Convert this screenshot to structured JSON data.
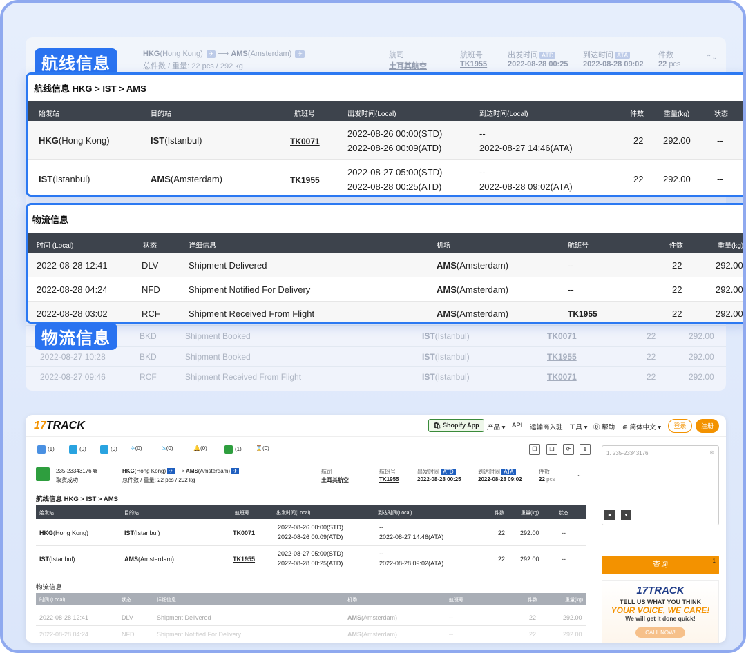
{
  "ghost_summary": {
    "origin_code": "HKG",
    "origin_name": "(Hong Kong)",
    "dest_code": "AMS",
    "dest_name": "(Amsterdam)",
    "weight_line": "总件数 / 重量: 22 pcs / 292 kg",
    "airline_label": "航司",
    "airline": "土耳其航空",
    "flight_label": "航班号",
    "flight": "TK1955",
    "dep_label": "出发时间",
    "dep_tag": "ATD",
    "dep_time": "2022-08-28 00:25",
    "arr_label": "到达时间",
    "arr_tag": "ATA",
    "arr_time": "2022-08-28 09:02",
    "pcs_label": "件数",
    "pcs": "22",
    "pcs_unit": "pcs"
  },
  "banners": {
    "route": "航线信息",
    "logistics": "物流信息"
  },
  "route_card": {
    "title": "航线信息   HKG > IST > AMS",
    "headers": [
      "始发站",
      "目的站",
      "航班号",
      "出发时间(Local)",
      "到达时间(Local)",
      "件数",
      "重量(kg)",
      "状态"
    ],
    "rows": [
      {
        "from_code": "HKG",
        "from_name": "(Hong Kong)",
        "to_code": "IST",
        "to_name": "(Istanbul)",
        "flight": "TK0071",
        "dep1": "2022-08-26 00:00(STD)",
        "dep2": "2022-08-26 00:09(ATD)",
        "arr1": "--",
        "arr2": "2022-08-27 14:46(ATA)",
        "pcs": "22",
        "weight": "292.00",
        "status": "--"
      },
      {
        "from_code": "IST",
        "from_name": "(Istanbul)",
        "to_code": "AMS",
        "to_name": "(Amsterdam)",
        "flight": "TK1955",
        "dep1": "2022-08-27 05:00(STD)",
        "dep2": "2022-08-28 00:25(ATD)",
        "arr1": "--",
        "arr2": "2022-08-28 09:02(ATA)",
        "pcs": "22",
        "weight": "292.00",
        "status": "--"
      }
    ]
  },
  "logistics_card": {
    "title": "物流信息",
    "headers": [
      "时间 (Local)",
      "状态",
      "详细信息",
      "机场",
      "航班号",
      "件数",
      "重量(kg)"
    ],
    "rows": [
      {
        "time": "2022-08-28 12:41",
        "status": "DLV",
        "detail": "Shipment Delivered",
        "ap_code": "AMS",
        "ap_name": "(Amsterdam)",
        "flight": "--",
        "pcs": "22",
        "weight": "292.00"
      },
      {
        "time": "2022-08-28 04:24",
        "status": "NFD",
        "detail": "Shipment Notified For Delivery",
        "ap_code": "AMS",
        "ap_name": "(Amsterdam)",
        "flight": "--",
        "pcs": "22",
        "weight": "292.00"
      },
      {
        "time": "2022-08-28 03:02",
        "status": "RCF",
        "detail": "Shipment Received From Flight",
        "ap_code": "AMS",
        "ap_name": "(Amsterdam)",
        "flight": "TK1955",
        "pcs": "22",
        "weight": "292.00"
      }
    ]
  },
  "ghost_rows": [
    {
      "time": "",
      "status": "BKD",
      "detail": "Shipment Booked",
      "ap_code": "IST",
      "ap_name": "(Istanbul)",
      "flight": "TK0071",
      "pcs": "22",
      "weight": "292.00"
    },
    {
      "time": "2022-08-27 10:28",
      "status": "BKD",
      "detail": "Shipment Booked",
      "ap_code": "IST",
      "ap_name": "(Istanbul)",
      "flight": "TK1955",
      "pcs": "22",
      "weight": "292.00"
    },
    {
      "time": "2022-08-27 09:46",
      "status": "RCF",
      "detail": "Shipment Received From Flight",
      "ap_code": "IST",
      "ap_name": "(Istanbul)",
      "flight": "TK0071",
      "pcs": "22",
      "weight": "292.00"
    }
  ],
  "app": {
    "logo_num": "17",
    "logo_text": "TRACK",
    "shopify": "Shopify App",
    "nav": [
      "产品 ▾",
      "API",
      "运输商入驻",
      "工具 ▾",
      "⓪ 帮助",
      "⊕ 简体中文 ▾"
    ],
    "login": "登录",
    "register": "注册",
    "filters": [
      "(1)",
      "(0)",
      "(0)",
      "(0)",
      "(0)",
      "(0)",
      "(1)",
      "(0)"
    ],
    "tracking_no": "235-23343176",
    "tracking_status": "取货成功",
    "summary_origin_code": "HKG",
    "summary_origin_name": "(Hong Kong)",
    "summary_dest_code": "AMS",
    "summary_dest_name": "(Amsterdam)",
    "summary_weight": "总件数 / 重量: 22 pcs / 292 kg",
    "airline_label": "航司",
    "airline": "土耳其航空",
    "flight_label": "航班号",
    "flight": "TK1955",
    "dep_label": "出发时间",
    "dep_tag": "ATD",
    "dep_time": "2022-08-28 00:25",
    "arr_label": "到达时间",
    "arr_tag": "ATA",
    "arr_time": "2022-08-28 09:02",
    "pcs_label": "件数",
    "pcs": "22",
    "pcs_unit": "pcs",
    "route_title": "航线信息   HKG > IST > AMS",
    "logistics_title": "物流信息",
    "input_value": "1. 235-23343176",
    "query": "查询",
    "query_badge": "1",
    "ad_logo": "17TRACK",
    "ad_line1": "TELL US WHAT YOU THINK",
    "ad_line2": "YOUR VOICE, WE CARE!",
    "ad_line3": "We will get it done quick!",
    "ad_btn": "CALL NOW!"
  }
}
